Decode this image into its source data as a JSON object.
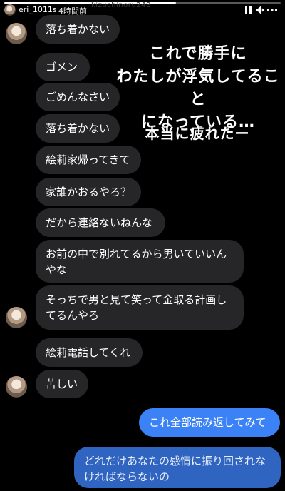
{
  "story": {
    "username": "eri_1011s",
    "time": "4時間前",
    "ghost_text": "kizuchinoru248",
    "progress": 0.62
  },
  "icons": {
    "pause": "pause-icon",
    "mute": "speaker-muted-icon",
    "more": "more-dots-icon",
    "avatar": "profile-avatar"
  },
  "messages": [
    {
      "text": "落ち着かない",
      "dir": "in"
    },
    {
      "text": "ゴメン",
      "dir": "in"
    },
    {
      "text": "ごめんなさい",
      "dir": "in"
    },
    {
      "text": "落ち着かない",
      "dir": "in"
    },
    {
      "text": "絵莉家帰ってきて",
      "dir": "in"
    },
    {
      "text": "家誰かおるやろ？",
      "dir": "in"
    },
    {
      "text": "だから連絡ないねんな",
      "dir": "in"
    },
    {
      "text": "お前の中で別れてるから男いていいん\nやな",
      "dir": "in"
    },
    {
      "text": "そっちで男と見て笑って金取る計画し\nてるんやろ",
      "dir": "in"
    },
    {
      "text": "絵莉電話してくれ",
      "dir": "in"
    },
    {
      "text": "苦しい",
      "dir": "in"
    },
    {
      "text": "これ全部読み返してみて",
      "dir": "out"
    },
    {
      "text": "どれだけあなたの感情に振り回されな\nければならないの",
      "dir": "out"
    }
  ],
  "overlays": {
    "main": "これで勝手に\nわたしが浮気してること\nになっている…",
    "sub": "本当に疲れたー"
  },
  "colors": {
    "background": "#000000",
    "incoming_bubble": "#262628",
    "outgoing_bubble": "#3b82f6"
  }
}
